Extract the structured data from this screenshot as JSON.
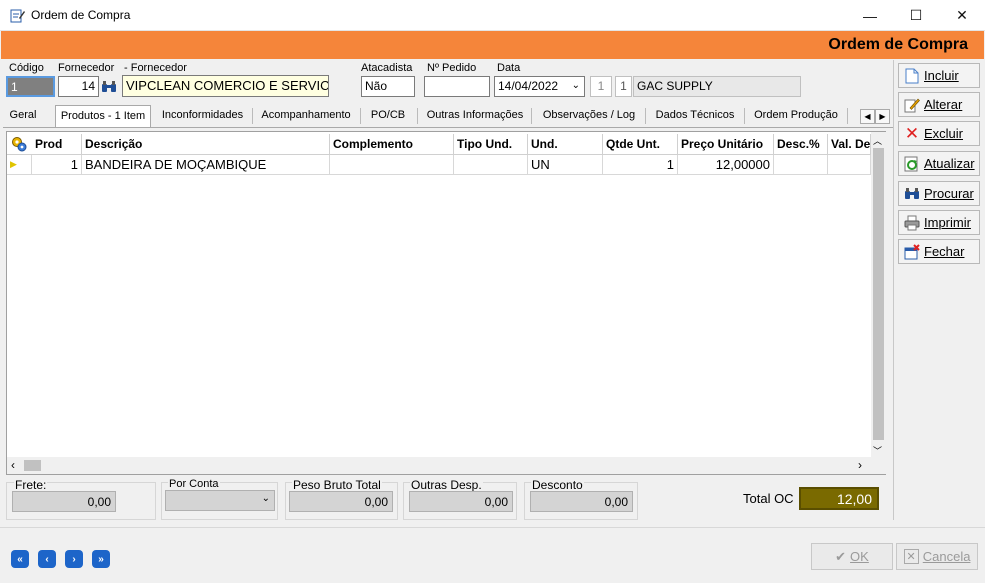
{
  "window": {
    "title": "Ordem de Compra",
    "minimize": "—",
    "maximize": "☐",
    "close": "✕"
  },
  "header": {
    "title": "Ordem de Compra",
    "accent": "#f5853a"
  },
  "fields": {
    "codigo_label": "Código",
    "codigo_value": "1",
    "fornecedor_label": "Fornecedor",
    "fornecedor_value": "14",
    "fornecedor_nome_label": "- Fornecedor",
    "fornecedor_nome_value": "VIPCLEAN COMERCIO E SERVIC",
    "atacadista_label": "Atacadista",
    "atacadista_value": "Não",
    "pedido_label": "Nº Pedido",
    "pedido_value": "",
    "data_label": "Data",
    "data_value": "14/04/2022",
    "small1": "1",
    "small2": "1",
    "empresa_value": "GAC SUPPLY"
  },
  "tabs": [
    {
      "label": "Geral"
    },
    {
      "label": "Produtos - 1 Item"
    },
    {
      "label": "Inconformidades"
    },
    {
      "label": "Acompanhamento"
    },
    {
      "label": "PO/CB"
    },
    {
      "label": "Outras Informações"
    },
    {
      "label": "Observações / Log"
    },
    {
      "label": "Dados Técnicos"
    },
    {
      "label": "Ordem Produção"
    }
  ],
  "grid": {
    "columns": [
      "Prod",
      "Descrição",
      "Complemento",
      "Tipo Und.",
      "Und.",
      "Qtde Unt.",
      "Preço Unitário",
      "Desc.%",
      "Val. De"
    ],
    "rows": [
      {
        "prod": "1",
        "descricao": "BANDEIRA DE MOÇAMBIQUE",
        "complemento": "",
        "tipo": "",
        "und": "UN",
        "qtde": "1",
        "preco": "12,00000",
        "desc": "",
        "val": ""
      }
    ]
  },
  "side_buttons": [
    {
      "label": "Incluir",
      "icon": "new-document-icon"
    },
    {
      "label": "Alterar",
      "icon": "edit-icon"
    },
    {
      "label": "Excluir",
      "icon": "delete-icon"
    },
    {
      "label": "Atualizar",
      "icon": "refresh-icon"
    },
    {
      "label": "Procurar",
      "icon": "binoculars-icon"
    },
    {
      "label": "Imprimir",
      "icon": "printer-icon"
    },
    {
      "label": "Fechar",
      "icon": "close-window-icon"
    }
  ],
  "totals": {
    "frete_label": "Frete:",
    "frete_value": "0,00",
    "por_conta_label": "Por Conta",
    "por_conta_value": "",
    "peso_label": "Peso Bruto Total",
    "peso_value": "0,00",
    "outras_label": "Outras Desp.",
    "outras_value": "0,00",
    "desconto_label": "Desconto",
    "desconto_value": "0,00",
    "total_label": "Total OC",
    "total_value": "12,00",
    "total_color": "#7a6a00"
  },
  "footer": {
    "ok_label": "OK",
    "cancel_label": "Cancela"
  }
}
